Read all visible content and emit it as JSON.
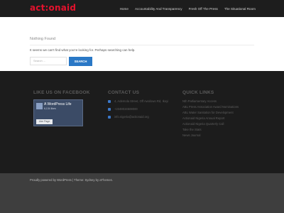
{
  "header": {
    "logo": "act:onaid",
    "nav": [
      "Home",
      "Accountability And Transparency",
      "Fresh Off The Press",
      "The Situational Room"
    ]
  },
  "main": {
    "title": "Nothing Found",
    "text": "It seems we can't find what you're looking for. Perhaps searching can help.",
    "search_placeholder": "Search ...",
    "search_button": "SEARCH"
  },
  "footer": {
    "facebook": {
      "title": "LIKE US ON FACEBOOK",
      "page_name": "A WordPress Life",
      "followers": "6,134 likes",
      "like_button": "Like Page"
    },
    "contact": {
      "title": "CONTACT US",
      "address": "4, Ademola Street, Off Awolowo Rd, Ikoyi",
      "phone": "+2348034508000",
      "email": "info.nigeria@actionaid.org"
    },
    "quick_links": {
      "title": "QUICK LINKS",
      "items": [
        "Nth Parliamentary Access",
        "ABL Press Association Award Nominations",
        "ABL Water Sanitation for Development",
        "Actionaid Nigeria Annual Report",
        "Actionaid Nigeria Quarterly Call",
        "Take the Stats",
        "News Journal"
      ]
    }
  },
  "bottom_bar": {
    "copyright": "Proudly powered by WordPress | Theme: Sydney by aThemes."
  },
  "colors": {
    "brand_red": "#e3122d",
    "accent_blue": "#2a78c6",
    "header_bg": "#1d1d1d",
    "footer_bg": "#1c1c1c",
    "bottom_bg": "#3e3e3e"
  }
}
